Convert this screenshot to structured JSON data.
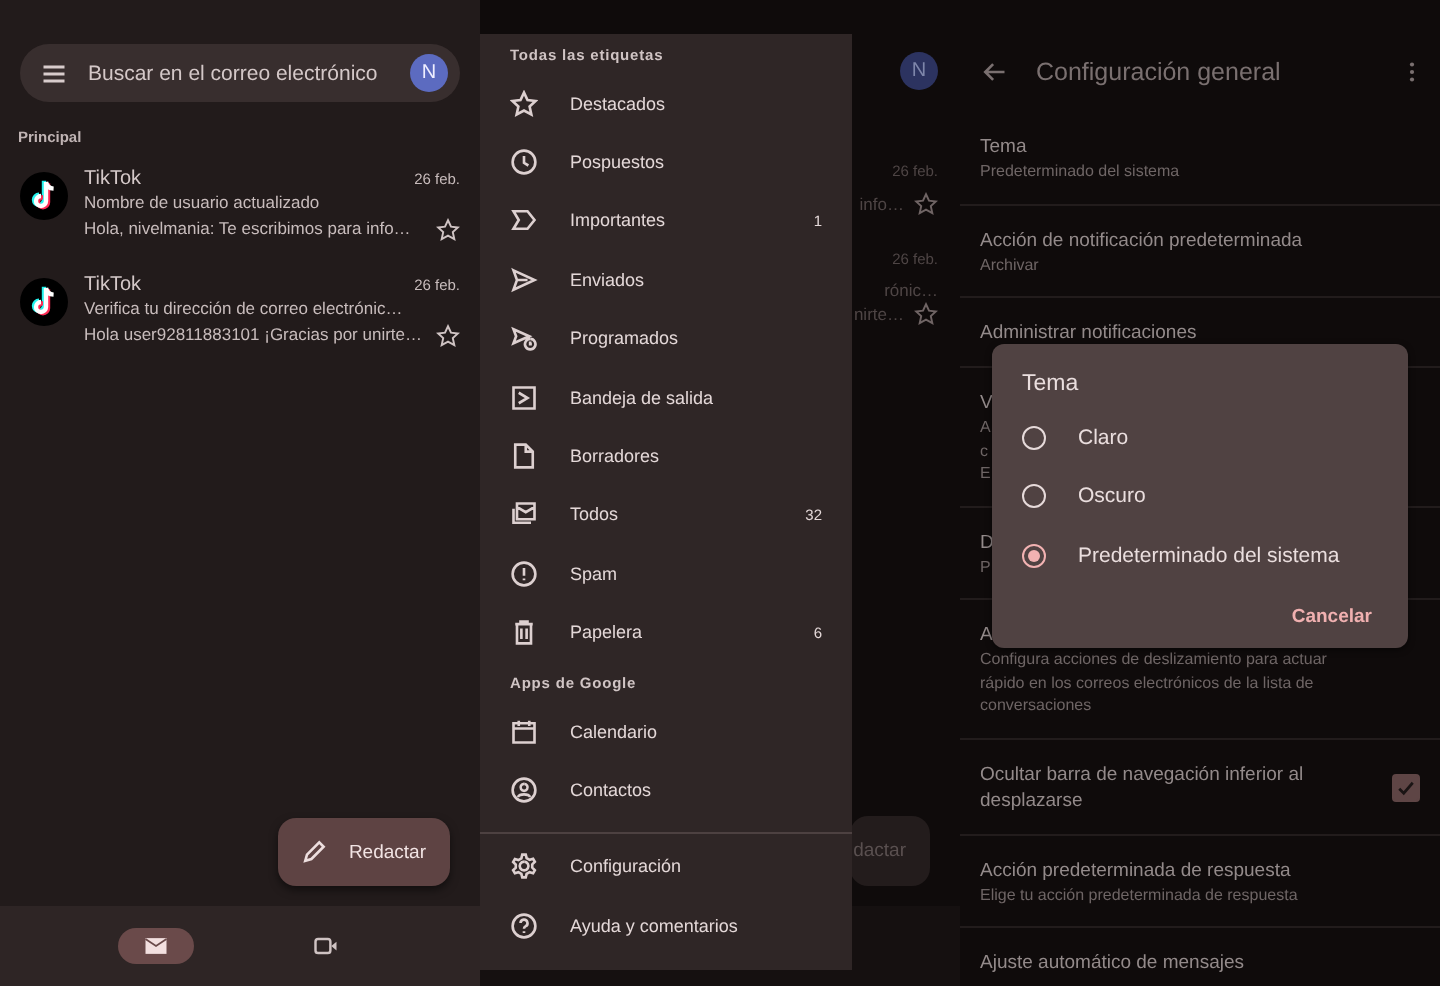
{
  "inbox": {
    "search": {
      "placeholder": "Buscar en el correo electrónico"
    },
    "avatar": "N",
    "section": "Principal",
    "emails": [
      {
        "sender": "TikTok",
        "date": "26 feb.",
        "subject": "Nombre de usuario actualizado",
        "snippet": "Hola, nivelmania: Te escribimos para info…",
        "starred": false
      },
      {
        "sender": "TikTok",
        "date": "26 feb.",
        "subject": "Verifica tu dirección de correo electrónic…",
        "snippet": "Hola user92811883101 ¡Gracias por unirte…",
        "starred": false
      }
    ],
    "compose": "Redactar",
    "nav": [
      {
        "selected": true
      },
      {
        "selected": false
      }
    ]
  },
  "drawer": {
    "sections": [
      {
        "heading": "Todas las etiquetas",
        "items": [
          {
            "label": "Destacados"
          },
          {
            "label": "Pospuestos"
          },
          {
            "label": "Importantes",
            "count": "1"
          },
          {
            "label": "Enviados"
          },
          {
            "label": "Programados"
          },
          {
            "label": "Bandeja de salida"
          },
          {
            "label": "Borradores"
          },
          {
            "label": "Todos",
            "count": "32"
          },
          {
            "label": "Spam"
          },
          {
            "label": "Papelera",
            "count": "6"
          }
        ]
      },
      {
        "heading": "Apps de Google",
        "items": [
          {
            "label": "Calendario"
          },
          {
            "label": "Contactos"
          }
        ]
      }
    ],
    "footer_items": [
      {
        "label": "Configuración"
      },
      {
        "label": "Ayuda y comentarios"
      }
    ],
    "behind": {
      "avatar": "N",
      "rows": [
        {
          "date": "26 feb.",
          "lines": [
            "info…"
          ]
        },
        {
          "date": "26 feb.",
          "lines": [
            "rónic…",
            "nirte…"
          ]
        }
      ],
      "compose": "dactar"
    }
  },
  "settings": {
    "title": "Configuración general",
    "rows": [
      {
        "title": "Tema",
        "subtitle": "Predeterminado del sistema"
      },
      {
        "title": "Acción de notificación predeterminada",
        "subtitle": "Archivar"
      },
      {
        "title": "Administrar notificaciones"
      },
      {
        "title": "V",
        "subtitle_lines": [
          "A",
          "c",
          "E"
        ]
      },
      {
        "title": "D",
        "subtitle_lines": [
          "P"
        ]
      },
      {
        "title": "A",
        "subtitle": "Configura acciones de deslizamiento para actuar rápido en los correos electrónicos de la lista de conversaciones"
      },
      {
        "title": "Ocultar barra de navegación inferior al desplazarse",
        "checked": true
      },
      {
        "title": "Acción predeterminada de respuesta",
        "subtitle": "Elige tu acción predeterminada de respuesta"
      },
      {
        "title": "Ajuste automático de mensajes"
      }
    ],
    "dialog": {
      "title": "Tema",
      "options": [
        {
          "label": "Claro",
          "selected": false
        },
        {
          "label": "Oscuro",
          "selected": false
        },
        {
          "label": "Predeterminado del sistema",
          "selected": true
        }
      ],
      "cancel": "Cancelar"
    }
  }
}
